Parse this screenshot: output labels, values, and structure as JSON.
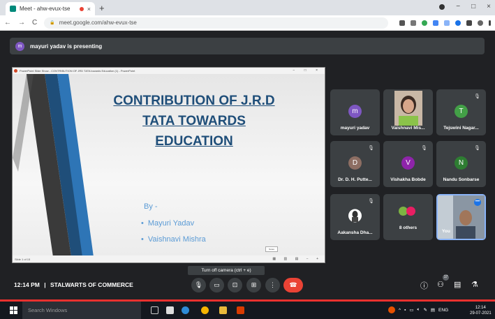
{
  "browser": {
    "tab_title": "Meet - ahw-evux-tse",
    "tab_close": "×",
    "new_tab": "+",
    "url": "meet.google.com/ahw-evux-tse",
    "nav_back": "←",
    "nav_forward": "→",
    "nav_reload": "C",
    "lock": "🔒",
    "win_min": "−",
    "win_max": "□",
    "win_close": "×"
  },
  "banner": {
    "avatar_letter": "m",
    "text": "mayuri yadav is presenting"
  },
  "presentation": {
    "window_title": "PowerPoint Slide Show - CONTRIBUTION OF JRD TATA towards Education (1) - PowerPoint",
    "title_line1": "CONTRIBUTION OF J.R.D",
    "title_line2": "TATA TOWARDS",
    "title_line3": "EDUCATION",
    "by": "By -",
    "bullets": [
      "Mayuri Yadav",
      "Vaishnavi Mishra"
    ],
    "status_left": "Slide 1 of 15",
    "notes_label": "Notes",
    "status_right": "▦ ▥ ▤ − +"
  },
  "participants": [
    {
      "name": "mayuri yadav",
      "letter": "m",
      "color": "#7e57c2"
    },
    {
      "name": "Vaishnavi Mis...",
      "letter": "",
      "color": "#9e9e9e"
    },
    {
      "name": "Tejswini Nagar...",
      "letter": "T",
      "color": "#43a047"
    },
    {
      "name": "Dr. D. H. Putte...",
      "letter": "D",
      "color": "#8d6e63"
    },
    {
      "name": "Vishakha Bobde",
      "letter": "V",
      "color": "#8e24aa"
    },
    {
      "name": "Nandu Sonbarse",
      "letter": "N",
      "color": "#2e7d32"
    },
    {
      "name": "Aakansha Dha...",
      "letter": "",
      "color": "#ffffff"
    },
    {
      "name": "8 others",
      "letter": "",
      "color": "#e91e63"
    },
    {
      "name": "You",
      "letter": "",
      "color": "#6d7b8a"
    }
  ],
  "controls": {
    "tooltip": "Turn off camera (ctrl + e)",
    "time": "12:14 PM",
    "separator": "|",
    "meeting_name": "STALWARTS OF COMMERCE",
    "people_count": "17"
  },
  "taskbar": {
    "search_placeholder": "Search Windows",
    "lang": "ENG",
    "time": "12:14",
    "date": "29-07-2021"
  }
}
